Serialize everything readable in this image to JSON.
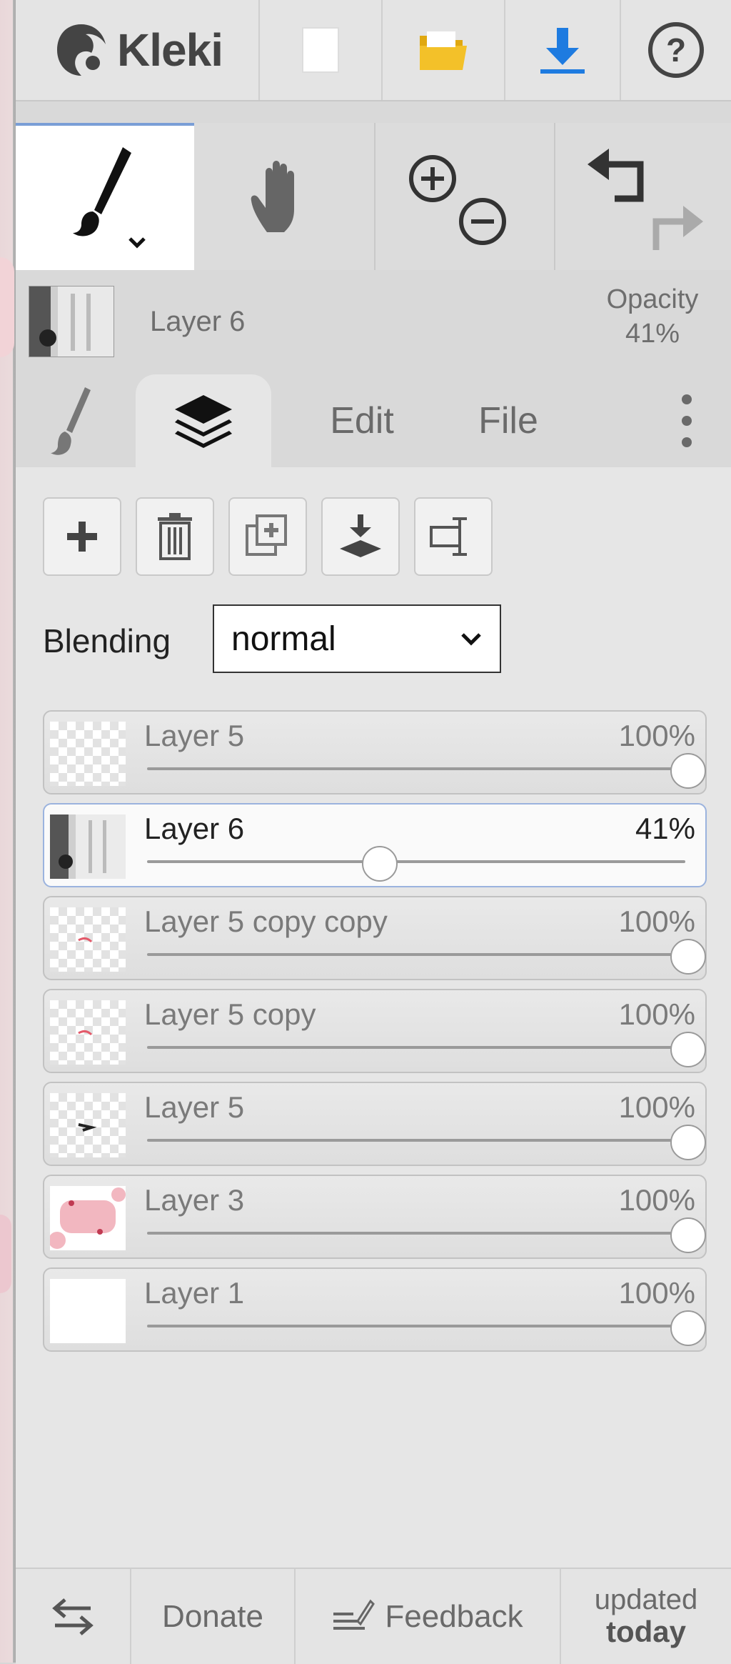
{
  "app": {
    "title": "Kleki"
  },
  "topbar": {
    "new_icon": "new-document-icon",
    "open_icon": "folder-open-icon",
    "save_icon": "download-icon",
    "help_icon": "help-icon"
  },
  "tools": {
    "brush_icon": "brush-icon",
    "hand_icon": "hand-icon",
    "zoom_in_icon": "zoom-in-icon",
    "zoom_out_icon": "zoom-out-icon",
    "undo_icon": "undo-icon",
    "redo_icon": "redo-icon"
  },
  "current_layer": {
    "name": "Layer 6",
    "opacity_label": "Opacity",
    "opacity_value": "41%"
  },
  "tabs": {
    "brush": "brush-icon",
    "layers": "layers-icon",
    "edit": "Edit",
    "file": "File",
    "more": "more-vertical-icon"
  },
  "blending": {
    "label": "Blending",
    "value": "normal"
  },
  "layers": [
    {
      "name": "Layer 5",
      "opacity": "100%",
      "level": 1.0,
      "thumb": "checker",
      "selected": false
    },
    {
      "name": "Layer 6",
      "opacity": "41%",
      "level": 0.41,
      "thumb": "photo",
      "selected": true
    },
    {
      "name": "Layer 5 copy copy",
      "opacity": "100%",
      "level": 1.0,
      "thumb": "checker-red",
      "selected": false
    },
    {
      "name": "Layer 5 copy",
      "opacity": "100%",
      "level": 1.0,
      "thumb": "checker-red",
      "selected": false
    },
    {
      "name": "Layer 5",
      "opacity": "100%",
      "level": 1.0,
      "thumb": "checker-dark",
      "selected": false
    },
    {
      "name": "Layer 3",
      "opacity": "100%",
      "level": 1.0,
      "thumb": "pink",
      "selected": false
    },
    {
      "name": "Layer 1",
      "opacity": "100%",
      "level": 1.0,
      "thumb": "white",
      "selected": false
    }
  ],
  "bottombar": {
    "swap_icon": "swap-icon",
    "donate": "Donate",
    "feedback": "Feedback",
    "updated": "updated",
    "when": "today"
  },
  "colors": {
    "accent_blue": "#1e7be0",
    "folder_yellow": "#f3c129",
    "selected_border": "#9bb3de"
  }
}
